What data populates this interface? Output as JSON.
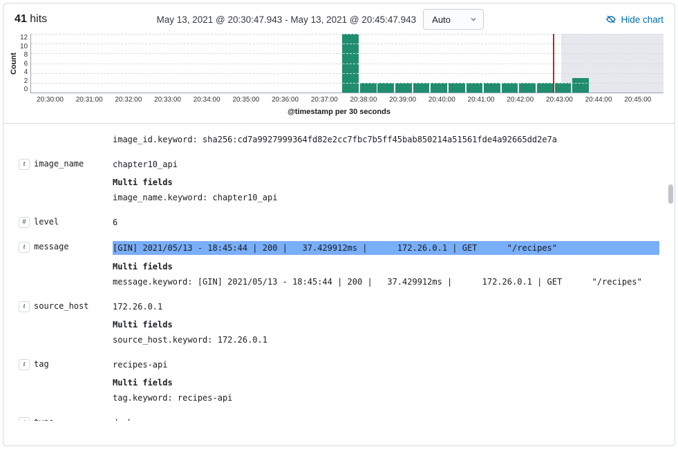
{
  "header": {
    "hits_count": "41",
    "hits_label": "hits",
    "timerange": "May 13, 2021 @ 20:30:47.943 - May 13, 2021 @ 20:45:47.943",
    "interval_selected": "Auto",
    "hide_chart": "Hide chart"
  },
  "chart_data": {
    "type": "bar",
    "ylabel": "Count",
    "xlabel": "@timestamp per 30 seconds",
    "yticks": [
      "12",
      "10",
      "8",
      "6",
      "4",
      "2",
      "0"
    ],
    "xticks": [
      "20:30:00",
      "20:31:00",
      "20:32:00",
      "20:33:00",
      "20:34:00",
      "20:35:00",
      "20:36:00",
      "20:37:00",
      "20:38:00",
      "20:39:00",
      "20:40:00",
      "20:41:00",
      "20:42:00",
      "20:43:00",
      "20:44:00",
      "20:45:00"
    ],
    "ylim": [
      0,
      12
    ],
    "cursor_xpct": 82.5,
    "shade_from_pct": 83.8,
    "bars": [
      {
        "xpct": 49.2,
        "wpct": 2.7,
        "value": 12
      },
      {
        "xpct": 52.0,
        "wpct": 2.7,
        "value": 2
      },
      {
        "xpct": 54.8,
        "wpct": 2.7,
        "value": 2
      },
      {
        "xpct": 57.6,
        "wpct": 2.7,
        "value": 2
      },
      {
        "xpct": 60.4,
        "wpct": 2.7,
        "value": 2
      },
      {
        "xpct": 63.2,
        "wpct": 2.7,
        "value": 2
      },
      {
        "xpct": 66.0,
        "wpct": 2.7,
        "value": 2
      },
      {
        "xpct": 68.8,
        "wpct": 2.7,
        "value": 2
      },
      {
        "xpct": 71.6,
        "wpct": 2.7,
        "value": 2
      },
      {
        "xpct": 74.4,
        "wpct": 2.7,
        "value": 2
      },
      {
        "xpct": 77.2,
        "wpct": 2.7,
        "value": 2
      },
      {
        "xpct": 80.0,
        "wpct": 2.7,
        "value": 2
      },
      {
        "xpct": 82.8,
        "wpct": 2.7,
        "value": 2
      },
      {
        "xpct": 85.6,
        "wpct": 2.7,
        "value": 3
      }
    ]
  },
  "multi_fields_label": "Multi fields",
  "fields": {
    "image_id_keyword": "image_id.keyword: sha256:cd7a9927999364fd82e2cc7fbc7b5ff45bab850214a51561fde4a92665dd2e7a",
    "image_name": {
      "key": "image_name",
      "value": "chapter10_api",
      "keyword": "image_name.keyword: chapter10_api"
    },
    "level": {
      "key": "level",
      "value": "6"
    },
    "message": {
      "key": "message",
      "value": "[GIN] 2021/05/13 - 18:45:44 | 200 |   37.429912ms |      172.26.0.1 | GET      \"/recipes\"",
      "keyword": "message.keyword: [GIN] 2021/05/13 - 18:45:44 | 200 |   37.429912ms |      172.26.0.1 | GET      \"/recipes\""
    },
    "source_host": {
      "key": "source_host",
      "value": "172.26.0.1",
      "keyword": "source_host.keyword: 172.26.0.1"
    },
    "tag": {
      "key": "tag",
      "value": "recipes-api",
      "keyword": "tag.keyword: recipes-api"
    },
    "type": {
      "key": "type",
      "value": "docker"
    }
  }
}
